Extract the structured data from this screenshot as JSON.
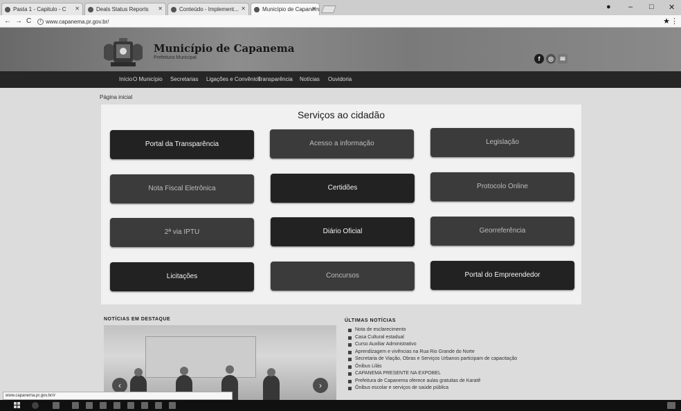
{
  "browser": {
    "tabs": [
      {
        "label": "Pasta 1 - Capitulo - C"
      },
      {
        "label": "Deals Status Reports"
      },
      {
        "label": "Conteúdo - Implement..."
      },
      {
        "label": "Município de Capanema"
      }
    ],
    "url": "www.capanema.pr.gov.br/"
  },
  "site": {
    "title": "Município de Capanema",
    "subtitle": "Prefeitura Municipal"
  },
  "nav": {
    "items": [
      "Início",
      "O Município",
      "Secretarias",
      "Ligações e Convênios",
      "Transparência",
      "Notícias",
      "Ouvidoria"
    ]
  },
  "content": {
    "breadcrumb": "Página inicial",
    "services_title": "Serviços ao cidadão",
    "services": [
      {
        "label": "Portal da Transparência"
      },
      {
        "label": "Acesso a informação"
      },
      {
        "label": "Legislação"
      },
      {
        "label": "Nota Fiscal Eletrônica"
      },
      {
        "label": "Certidões"
      },
      {
        "label": "Protocolo Online"
      },
      {
        "label": "2ª via IPTU"
      },
      {
        "label": "Diário Oficial"
      },
      {
        "label": "Georreferência"
      },
      {
        "label": "Licitações"
      },
      {
        "label": "Concursos"
      },
      {
        "label": "Portal do Empreendedor"
      }
    ],
    "news_photo_title": "NOTÍCIAS EM DESTAQUE",
    "latest_title": "ÚLTIMAS NOTÍCIAS",
    "latest": [
      "Nota de esclarecimento",
      "Casa Cultural estadual",
      "Curso Auxiliar Administrativo",
      "Aprendizagem e vivências na Rua Rio Grande do Norte",
      "Secretaria de Viação, Obras e Serviços Urbanos participam de capacitação",
      "Ônibus Lilás",
      "CAPANEMA PRESENTE NA EXPOBEL",
      "Prefeitura de Capanema oferece aulas gratuitas de Karatê",
      "Ônibus escolar e serviços de saúde pública"
    ],
    "status_url": "www.capanema.pr.gov.br/#"
  }
}
